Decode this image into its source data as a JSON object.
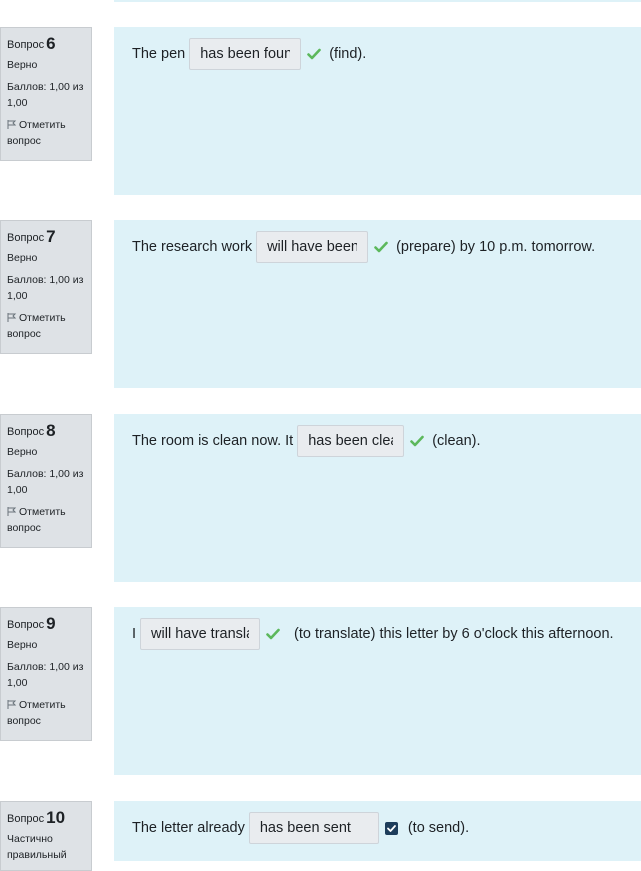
{
  "questions": [
    {
      "label": "Вопрос",
      "number": "6",
      "state": "Верно",
      "grade": "Баллов: 1,00 из 1,00",
      "flag": "Отметить вопрос",
      "before": "The pen",
      "answer": "has been found",
      "after": "(find).",
      "status": "correct"
    },
    {
      "label": "Вопрос",
      "number": "7",
      "state": "Верно",
      "grade": "Баллов: 1,00 из 1,00",
      "flag": "Отметить вопрос",
      "before": "The research work",
      "answer": "will have been prepared",
      "after": "(prepare) by 10 p.m. tomorrow.",
      "status": "correct"
    },
    {
      "label": "Вопрос",
      "number": "8",
      "state": "Верно",
      "grade": "Баллов: 1,00 из 1,00",
      "flag": "Отметить вопрос",
      "before": "The room is clean now. It",
      "answer": "has been cleaned",
      "after": "(clean).",
      "status": "correct"
    },
    {
      "label": "Вопрос",
      "number": "9",
      "state": "Верно",
      "grade": "Баллов: 1,00 из 1,00",
      "flag": "Отметить вопрос",
      "before": "I",
      "answer": "will have translated",
      "after": "(to translate) this letter by 6 o'clock this afternoon.",
      "status": "correct"
    },
    {
      "label": "Вопрос",
      "number": "10",
      "state": "Частично правильный",
      "grade": "",
      "flag": "",
      "before": "The letter already",
      "answer": "has been sent",
      "after": "(to send).",
      "status": "partial"
    }
  ],
  "colors": {
    "correct_icon": "#5cb85c",
    "partial_icon": "#1d3d5b",
    "content_bg": "#def2f8",
    "info_bg": "#dee2e6"
  }
}
